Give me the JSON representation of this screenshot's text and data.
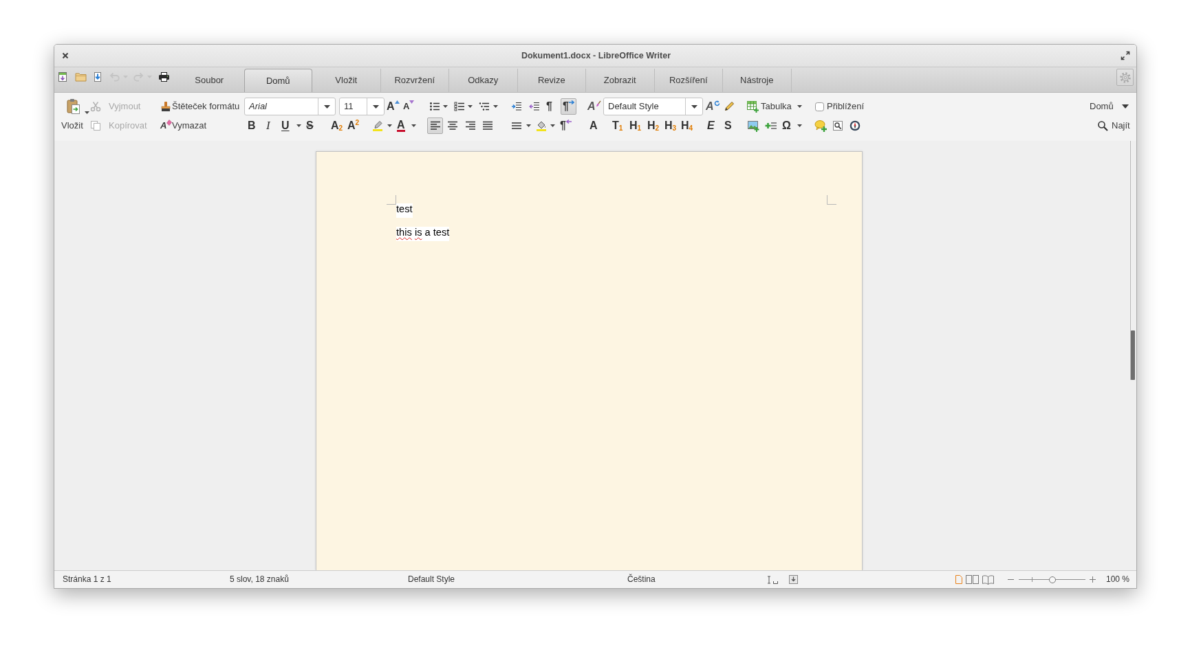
{
  "window": {
    "title": "Dokument1.docx - LibreOffice Writer"
  },
  "quick_access": {
    "undo": {
      "disabled": true
    },
    "redo": {
      "disabled": true
    }
  },
  "tabs": [
    {
      "label": "Soubor",
      "selected": false
    },
    {
      "label": "Domů",
      "selected": true
    },
    {
      "label": "Vložit",
      "selected": false
    },
    {
      "label": "Rozvržení",
      "selected": false
    },
    {
      "label": "Odkazy",
      "selected": false
    },
    {
      "label": "Revize",
      "selected": false
    },
    {
      "label": "Zobrazit",
      "selected": false
    },
    {
      "label": "Rozšíření",
      "selected": false
    },
    {
      "label": "Nástroje",
      "selected": false
    }
  ],
  "toolbar": {
    "paste": {
      "label": "Vložit"
    },
    "cut": {
      "label": "Vyjmout",
      "disabled": true
    },
    "copy": {
      "label": "Kopírovat",
      "disabled": true
    },
    "clone_formatting": {
      "label": "Štěteček formátu"
    },
    "clear_formatting": {
      "glyph": "A",
      "label": "Vymazat"
    },
    "font_name": {
      "value": "Arial"
    },
    "font_size": {
      "value": "11"
    },
    "grow_font": {
      "glyph": "A"
    },
    "shrink_font": {
      "glyph": "A"
    },
    "formatting_marks": {
      "glyph": "¶",
      "on": false
    },
    "left_to_right": {
      "glyph": "¶",
      "on": true
    },
    "manage_styles": {
      "glyph": "A"
    },
    "paragraph_style": {
      "value": "Default Style"
    },
    "update_style": {
      "glyph": "A"
    },
    "table": {
      "label": "Tabulka"
    },
    "zoom_checkbox": {
      "label": "Přiblížení",
      "checked": false
    },
    "menu": {
      "label": "Domů"
    },
    "character_format": [
      {
        "kind": "bold",
        "glyph": "B"
      },
      {
        "kind": "italic",
        "glyph": "I"
      },
      {
        "kind": "underline",
        "glyph": "U"
      },
      {
        "kind": "strikethrough",
        "glyph": "S"
      },
      {
        "kind": "subscript",
        "glyph": "A$_{2}$"
      },
      {
        "kind": "superscript",
        "glyph": "A$^{2}$"
      }
    ],
    "font_color": {
      "glyph": "A"
    },
    "alignment": [
      {
        "selected": true
      },
      {
        "selected": false
      },
      {
        "selected": false
      },
      {
        "selected": false
      }
    ],
    "right_to_left": {
      "glyph": "¶",
      "on": false
    },
    "style_presets": [
      {
        "kind": "plain",
        "glyph": "A"
      },
      {
        "kind": "indexed",
        "glyph": "T$_{1}$"
      },
      {
        "kind": "indexed",
        "glyph": "H$_{1}$"
      },
      {
        "kind": "indexed",
        "glyph": "H$_{2}$"
      },
      {
        "kind": "indexed",
        "glyph": "H$_{3}$"
      },
      {
        "kind": "indexed",
        "glyph": "H$_{4}$"
      },
      {
        "kind": "emphasis",
        "glyph": "E"
      },
      {
        "kind": "strong",
        "glyph": "S"
      }
    ],
    "special_character": {
      "glyph": "Ω"
    },
    "find": {
      "label": "Najít"
    }
  },
  "document": {
    "paragraphs": [
      {
        "words": [
          {
            "text": "test",
            "misspelled": false
          }
        ]
      },
      {
        "words": [
          {
            "text": "this",
            "misspelled": true
          },
          {
            "text": "is",
            "misspelled": true
          },
          {
            "text": "a",
            "misspelled": false
          },
          {
            "text": "test",
            "misspelled": false
          }
        ]
      }
    ]
  },
  "status_bar": {
    "page": "Stránka 1 z 1",
    "word_count": "5 slov, 18 znaků",
    "page_style": "Default Style",
    "language": "Čeština",
    "view_layouts": [
      {
        "selected": true
      },
      {
        "selected": false
      },
      {
        "selected": false
      }
    ],
    "zoom": {
      "level": 0.5
    },
    "zoom_percent": "100 %"
  }
}
